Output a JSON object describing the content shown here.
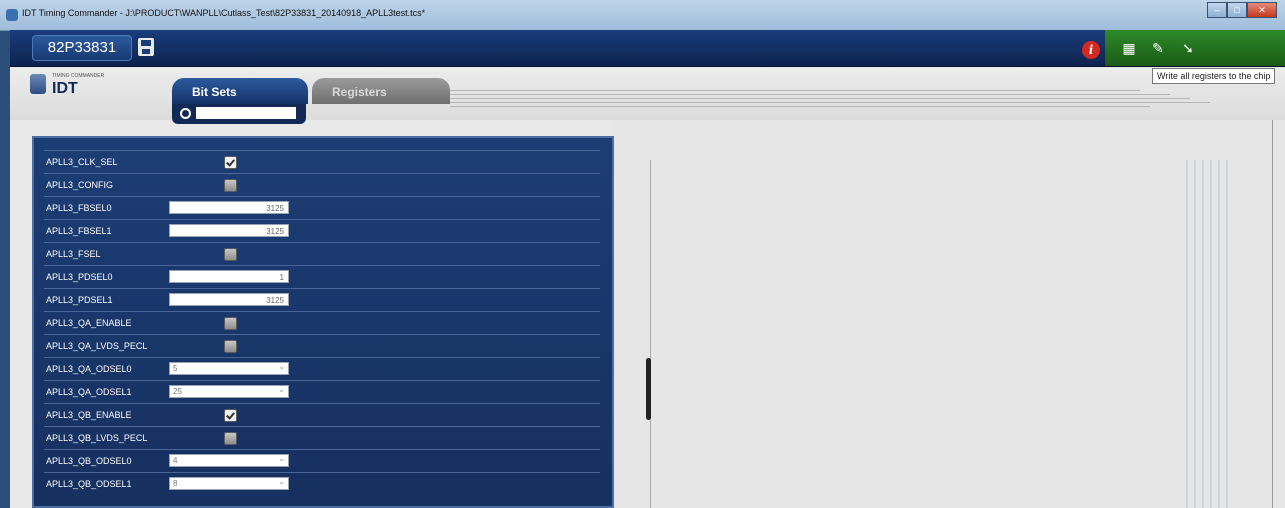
{
  "window": {
    "title": "IDT Timing Commander - J:\\PRODUCT\\WANPLL\\Cutlass_Test\\82P33831_20140918_APLL3test.tcs*"
  },
  "header": {
    "chip": "82P33831",
    "tooltip": "Write all registers to the chip",
    "logo_small": "TIMING COMMANDER",
    "logo": "IDT"
  },
  "tabs": [
    {
      "label": "Bit Sets",
      "active": true
    },
    {
      "label": "Registers",
      "active": false
    }
  ],
  "search": {
    "placeholder": ""
  },
  "bitsets": {
    "rows": [
      {
        "name": "APLL3_CLK_SEL",
        "type": "checkbox",
        "checked": true
      },
      {
        "name": "APLL3_CONFIG",
        "type": "checkbox",
        "checked": false
      },
      {
        "name": "APLL3_FBSEL0",
        "type": "number",
        "value": "3125"
      },
      {
        "name": "APLL3_FBSEL1",
        "type": "number",
        "value": "3125"
      },
      {
        "name": "APLL3_FSEL",
        "type": "checkbox",
        "checked": false
      },
      {
        "name": "APLL3_PDSEL0",
        "type": "number",
        "value": "1"
      },
      {
        "name": "APLL3_PDSEL1",
        "type": "number",
        "value": "3125"
      },
      {
        "name": "APLL3_QA_ENABLE",
        "type": "checkbox",
        "checked": false
      },
      {
        "name": "APLL3_QA_LVDS_PECL",
        "type": "checkbox",
        "checked": false
      },
      {
        "name": "APLL3_QA_ODSEL0",
        "type": "select",
        "value": "5"
      },
      {
        "name": "APLL3_QA_ODSEL1",
        "type": "select",
        "value": "25"
      },
      {
        "name": "APLL3_QB_ENABLE",
        "type": "checkbox",
        "checked": true
      },
      {
        "name": "APLL3_QB_LVDS_PECL",
        "type": "checkbox",
        "checked": false
      },
      {
        "name": "APLL3_QB_ODSEL0",
        "type": "select",
        "value": "4"
      },
      {
        "name": "APLL3_QB_ODSEL1",
        "type": "select",
        "value": "8"
      }
    ]
  },
  "colors": {
    "header": "#1a3d7a",
    "panel": "#1c3d75",
    "tab_active": "#2c5a9e",
    "tab_inactive": "#8c8c8c",
    "info": "#d22a1e",
    "toolbar_green": "#2e8a2a"
  },
  "icons": [
    "app-icon",
    "save-icon",
    "info-icon",
    "read-registers-icon",
    "write-registers-icon",
    "write-all-registers-icon",
    "search-icon"
  ]
}
